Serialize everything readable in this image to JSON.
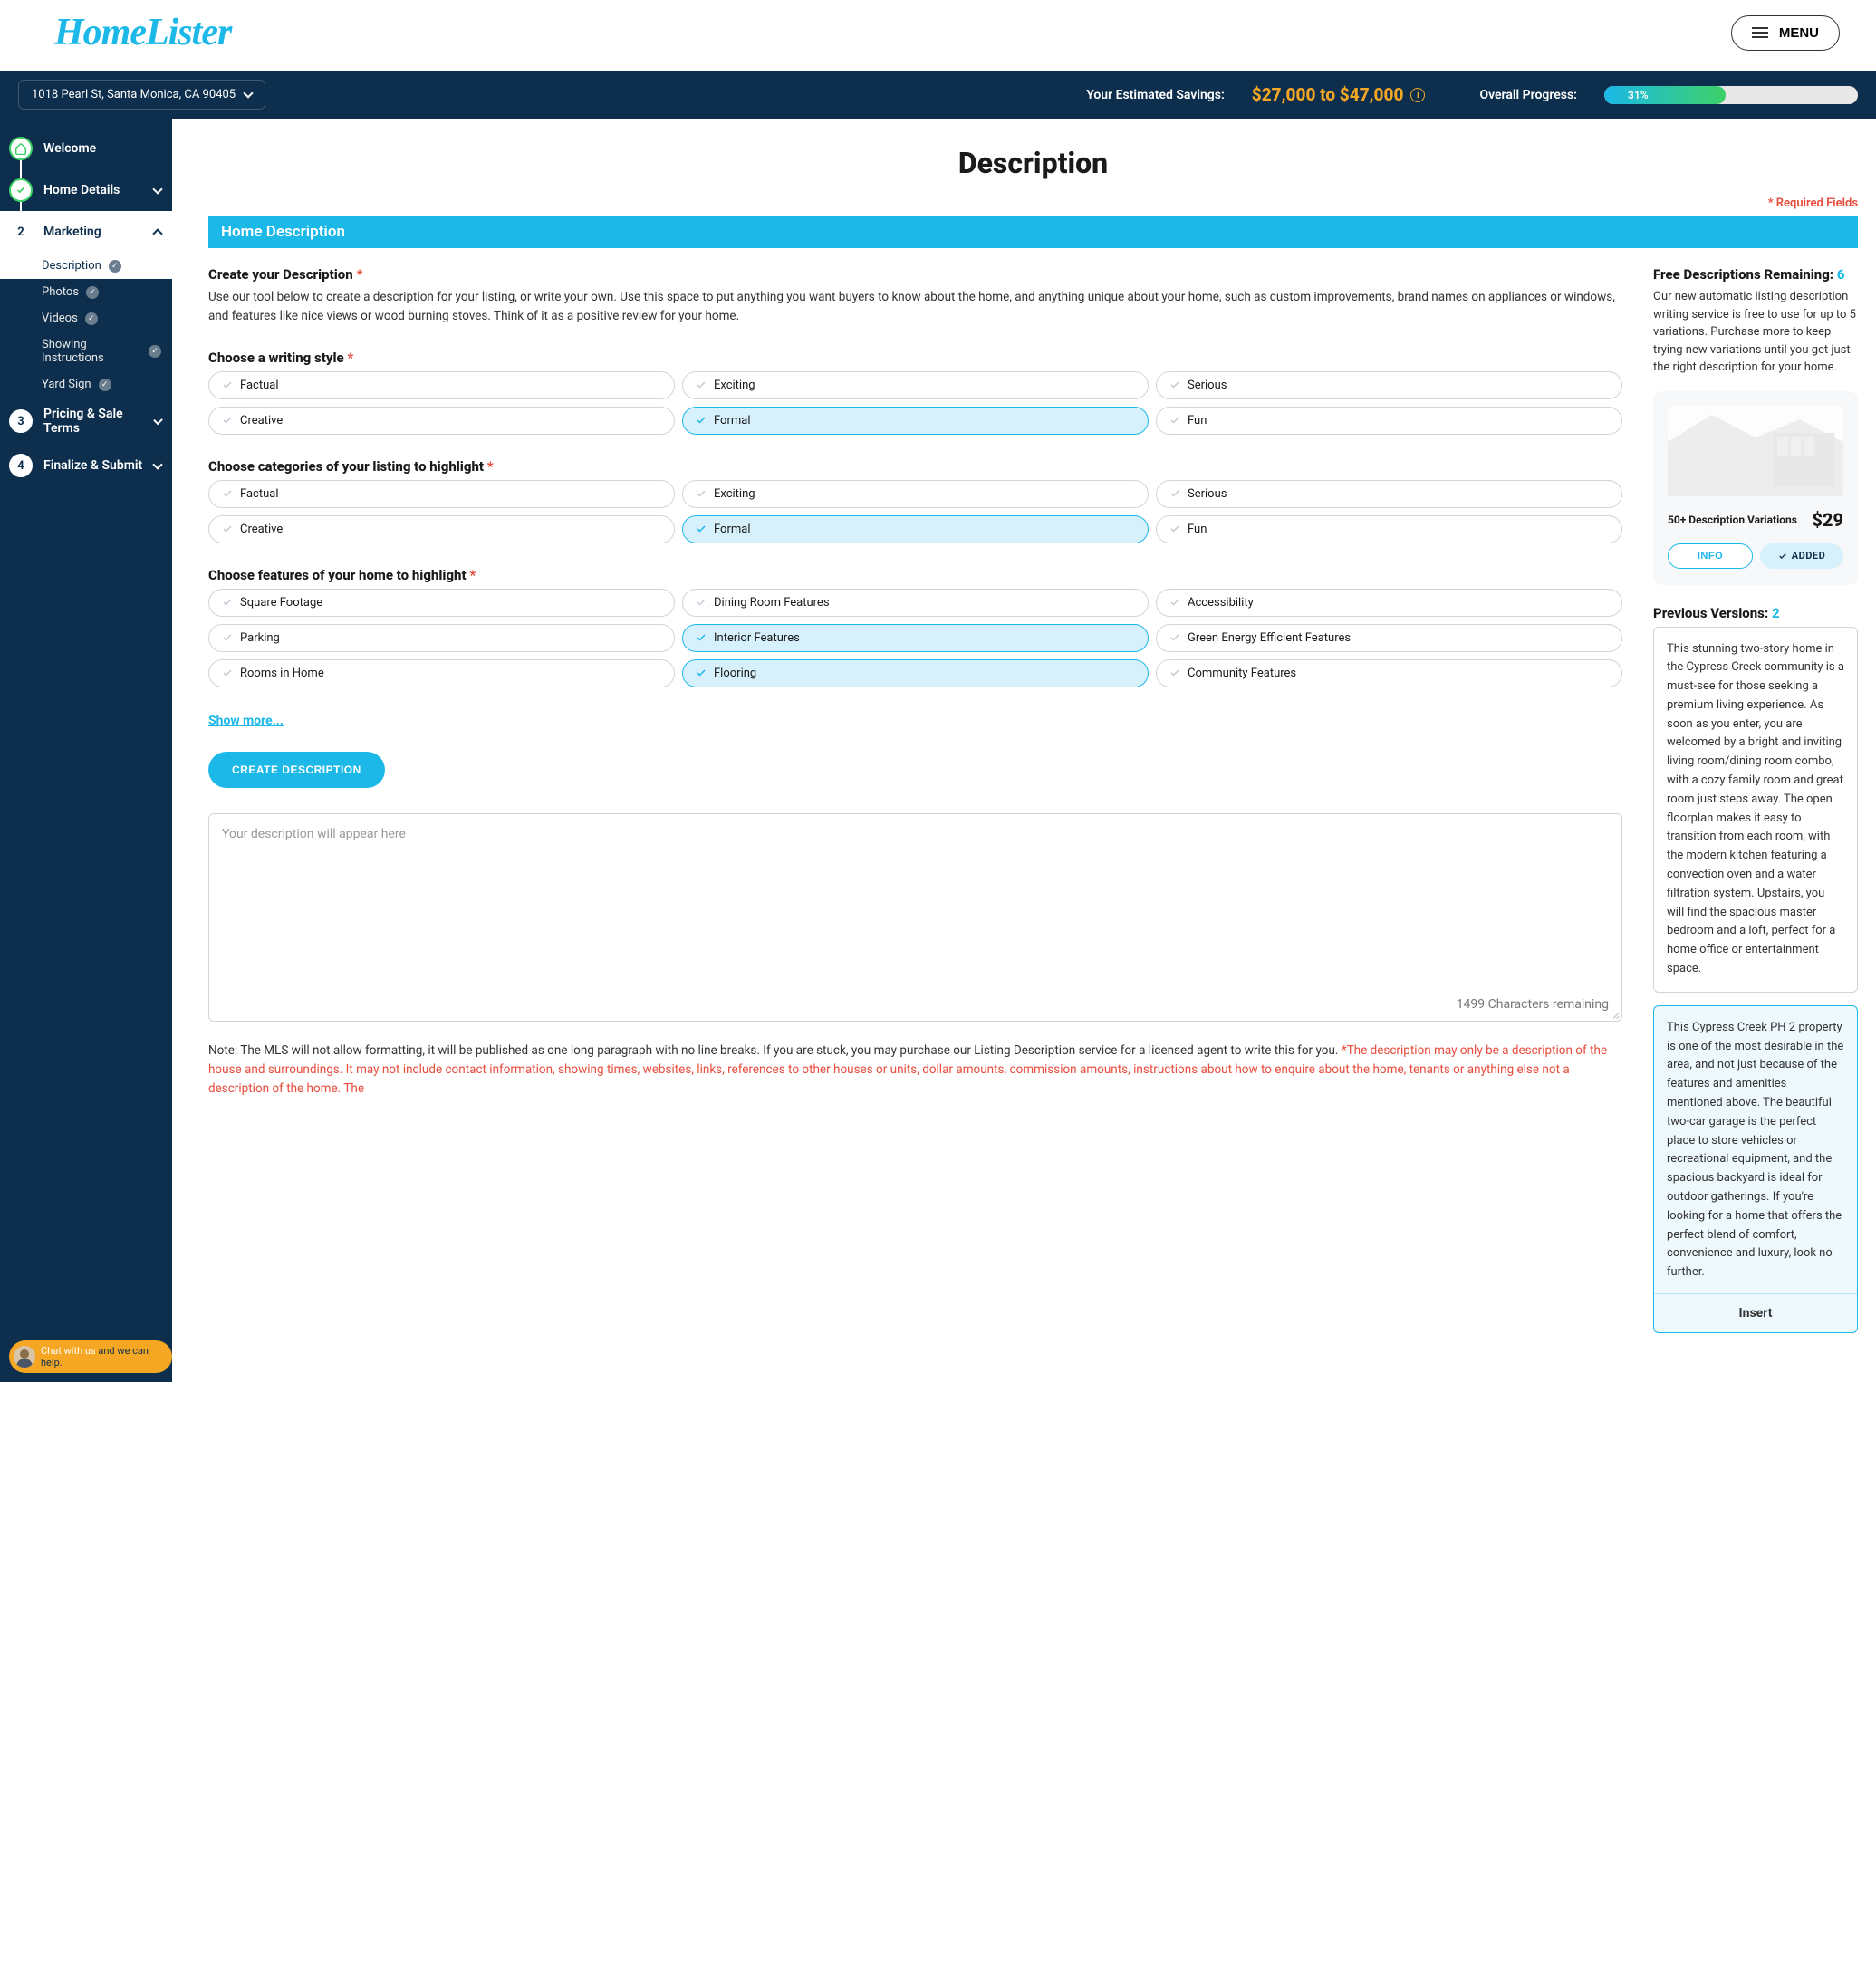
{
  "header": {
    "logo": "HomeLister",
    "menu": "MENU"
  },
  "topbar": {
    "address": "1018 Pearl St, Santa Monica, CA 90405",
    "savings_label": "Your Estimated Savings:",
    "savings_value": "$27,000 to $47,000",
    "progress_label": "Overall Progress:",
    "progress_pct": "31%",
    "progress_width": 48
  },
  "sidebar": {
    "steps": [
      {
        "label": "Welcome"
      },
      {
        "label": "Home Details"
      },
      {
        "label": "Marketing",
        "num": "2"
      },
      {
        "label": "Pricing & Sale Terms",
        "num": "3"
      },
      {
        "label": "Finalize & Submit",
        "num": "4"
      }
    ],
    "substeps": [
      {
        "label": "Description"
      },
      {
        "label": "Photos"
      },
      {
        "label": "Videos"
      },
      {
        "label": "Showing Instructions"
      },
      {
        "label": "Yard Sign"
      }
    ],
    "chat_pre": "Chat with us",
    "chat_post": " and we can help."
  },
  "page": {
    "title": "Description",
    "required": "* Required Fields",
    "section_bar": "Home Description"
  },
  "create": {
    "heading": "Create your Description",
    "body": "Use our tool below to create a description for your listing, or write your own. Use this space to put anything you want buyers to know about the home, and anything unique about your home, such as custom improvements, brand names on appliances or windows, and features like nice views or wood burning stoves. Think of it as a positive review for your home."
  },
  "style": {
    "heading": "Choose a writing style",
    "options": [
      "Factual",
      "Exciting",
      "Serious",
      "Creative",
      "Formal",
      "Fun"
    ],
    "selected": [
      4
    ]
  },
  "categories": {
    "heading": "Choose categories of your listing to highlight",
    "options": [
      "Factual",
      "Exciting",
      "Serious",
      "Creative",
      "Formal",
      "Fun"
    ],
    "selected": [
      4
    ]
  },
  "features": {
    "heading": "Choose features of your home to highlight",
    "options": [
      "Square Footage",
      "Dining Room Features",
      "Accessibility",
      "Parking",
      "Interior Features",
      "Green Energy Efficient Features",
      "Rooms in Home",
      "Flooring",
      "Community Features"
    ],
    "selected": [
      4,
      7
    ],
    "show_more": "Show more..."
  },
  "actions": {
    "create_button": "CREATE DESCRIPTION",
    "placeholder": "Your description will appear here",
    "char_count": "1499 Characters remaining"
  },
  "note": {
    "black": "Note: The MLS will not allow formatting, it will be published as one long paragraph with no line breaks. If you are stuck, you may purchase our Listing Description service for a licensed agent to write this for you. ",
    "red": "*The description may only be a description of the house and surroundings. It may not include contact information, showing times, websites, links, references to other houses or units, dollar amounts, commission amounts, instructions about how to enquire about the home, tenants or anything else not a description of the home. The"
  },
  "right": {
    "free_label": "Free Descriptions Remaining: ",
    "free_count": "6",
    "free_desc": "Our new automatic listing description writing service is free to use for up to 5 variations. Purchase more to keep trying new variations until you get just the right description for your home.",
    "promo_label": "50+ Description Variations",
    "promo_price": "$29",
    "info_btn": "INFO",
    "added_btn": "ADDED",
    "prev_label": "Previous Versions: ",
    "prev_count": "2",
    "v1": "This stunning two-story home in the Cypress Creek community is a must-see for those seeking a premium living experience. As soon as you enter, you are welcomed by a bright and inviting living room/dining room combo, with a cozy family room and great room just steps away. The open floorplan makes it easy to transition from each room, with the modern kitchen featuring a convection oven and a water filtration system. Upstairs, you will find the spacious master bedroom and a loft, perfect for a home office or entertainment space.",
    "v2": "This Cypress Creek PH 2 property is one of the most desirable in the area, and not just because of the features and amenities mentioned above. The beautiful two-car garage is the perfect place to store vehicles or recreational equipment, and the spacious backyard is ideal for outdoor gatherings. If you're looking for a home that offers the perfect blend of comfort, convenience and luxury, look no further.",
    "insert": "Insert"
  }
}
